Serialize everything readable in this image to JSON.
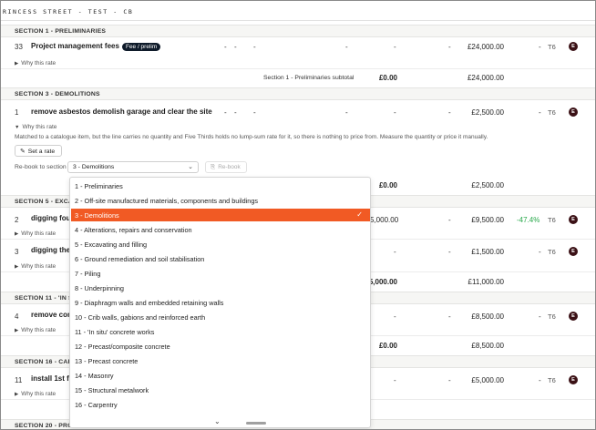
{
  "title": "RINCESS STREET - TEST - CB",
  "sections": {
    "s1": "SECTION 1 - PRELIMINARIES",
    "s3": "SECTION 3 - DEMOLITIONS",
    "s5": "SECTION 5 - EXCAV",
    "s11": "SECTION 11 - 'IN SI",
    "s16": "SECTION 16 - CARP",
    "s20": "SECTION 20 - PRO"
  },
  "dash": "-",
  "why_rate": "Why this rate",
  "t6": "T6",
  "avatar": "E",
  "rows": {
    "r33": {
      "num": "33",
      "desc": "Project management fees",
      "badge": "Fee / prelim",
      "amount": "£24,000.00"
    },
    "r1": {
      "num": "1",
      "desc": "remove asbestos demolish garage and clear the site",
      "amount": "£2,500.00"
    },
    "r2": {
      "num": "2",
      "desc": "digging fou",
      "rate": "5,000.00",
      "amount": "£9,500.00",
      "pct": "-47.4%"
    },
    "r3": {
      "num": "3",
      "desc": "digging the",
      "amount": "£1,500.00"
    },
    "r4": {
      "num": "4",
      "desc": "remove con",
      "amount": "£8,500.00"
    },
    "r11": {
      "num": "11",
      "desc": "install 1st flo",
      "amount": "£5,000.00"
    }
  },
  "subtotals": {
    "s1_label": "Section 1 - Preliminaries subtotal",
    "s1_zero": "£0.00",
    "s1_total": "£24,000.00",
    "s3_zero": "£0.00",
    "s3_total": "£2,500.00",
    "s5_rate": "5,000.00",
    "s5_total": "£11,000.00",
    "s11_zero": "£0.00",
    "s11_total": "£8,500.00"
  },
  "note": "Matched to a catalogue item, but the line carries no quantity and Five Thirds holds no lump-sum rate for it, so there is nothing to price from. Measure the quantity or price it manually.",
  "set_rate": "Set a rate",
  "rebook_label": "Re-book to section",
  "rebook_selected": "3 - Demolitions",
  "rebook_button": "Re-book",
  "options": [
    "1 - Preliminaries",
    "2 - Off-site manufactured materials, components and buildings",
    "3 - Demolitions",
    "4 - Alterations, repairs and conservation",
    "5 - Excavating and filling",
    "6 - Ground remediation and soil stabilisation",
    "7 - Piling",
    "8 - Underpinning",
    "9 - Diaphragm walls and embedded retaining walls",
    "10 - Crib walls, gabions and reinforced earth",
    "11 - 'In situ' concrete works",
    "12 - Precast/composite concrete",
    "13 - Precast concrete",
    "14 - Masonry",
    "15 - Structural metalwork",
    "16 - Carpentry"
  ],
  "colors": {
    "accent": "#f15a24",
    "badge": "#0f1b2a",
    "avatar": "#3b1116",
    "positive": "#27a84a"
  }
}
